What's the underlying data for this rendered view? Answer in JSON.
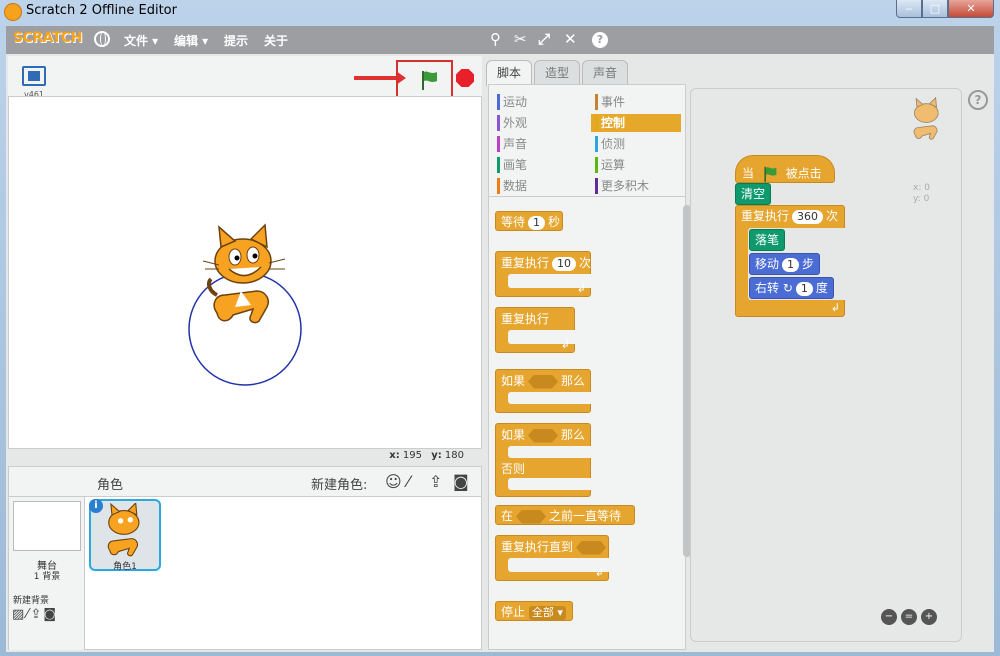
{
  "window": {
    "title": "Scratch 2 Offline Editor",
    "min": "‒",
    "max": "□",
    "close": "✕"
  },
  "menu": {
    "logo": "SCRATCH",
    "items": [
      "文件 ▾",
      "编辑 ▾",
      "提示",
      "关于"
    ],
    "tools": [
      "duplicate-icon",
      "delete-icon",
      "grow-icon",
      "shrink-icon",
      "help-icon"
    ]
  },
  "stage": {
    "version": "v461",
    "coords": {
      "x_label": "x:",
      "x": "195",
      "y_label": "y:",
      "y": "180"
    }
  },
  "sprites_panel": {
    "title": "角色",
    "new_sprite": "新建角色:",
    "stage_label": "舞台",
    "stage_backdrops": "1 背景",
    "new_backdrop": "新建背景",
    "sprite_name": "角色1",
    "info": "i"
  },
  "tabs": [
    "脚本",
    "造型",
    "声音"
  ],
  "categories": [
    {
      "label": "运动",
      "color": "#4a6cd4"
    },
    {
      "label": "事件",
      "color": "#c88330"
    },
    {
      "label": "外观",
      "color": "#8a55d7"
    },
    {
      "label": "控制",
      "color": "#e1a91a"
    },
    {
      "label": "声音",
      "color": "#bb42c3"
    },
    {
      "label": "侦测",
      "color": "#2ca5e2"
    },
    {
      "label": "画笔",
      "color": "#0e9a6c"
    },
    {
      "label": "运算",
      "color": "#5cb712"
    },
    {
      "label": "数据",
      "color": "#ee7d16"
    },
    {
      "label": "更多积木",
      "color": "#632d99"
    }
  ],
  "palette": {
    "wait": {
      "a": "等待",
      "n": "1",
      "b": "秒"
    },
    "repeat": {
      "a": "重复执行",
      "n": "10",
      "b": "次"
    },
    "forever": "重复执行",
    "if": {
      "a": "如果",
      "b": "那么"
    },
    "ifelse": {
      "a": "如果",
      "b": "那么",
      "c": "否则"
    },
    "waituntil": {
      "a": "在",
      "b": "之前一直等待"
    },
    "repeatuntil": "重复执行直到",
    "stop": {
      "a": "停止",
      "b": "全部 ▾"
    }
  },
  "script": {
    "sprite_xy": "x: 0\ny: 0",
    "hat": {
      "a": "当",
      "b": "被点击"
    },
    "clear": "清空",
    "repeat": {
      "a": "重复执行",
      "n": "360",
      "b": "次"
    },
    "pendown": "落笔",
    "move": {
      "a": "移动",
      "n": "1",
      "b": "步"
    },
    "turn": {
      "a": "右转",
      "n": "1",
      "b": "度"
    },
    "help": "?"
  },
  "colors": {
    "control": "#e5a52f",
    "pen": "#0e9a6c",
    "motion": "#4a6cd4",
    "flag": "#2e8b2e",
    "stop": "#e8202a"
  }
}
